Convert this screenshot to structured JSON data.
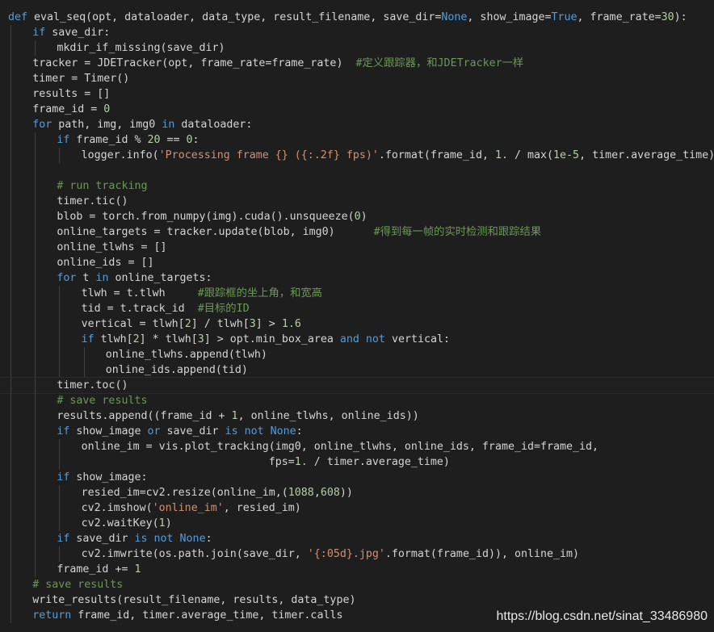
{
  "editor": {
    "lines": [
      {
        "indent": 0,
        "tokens": [
          [
            "kw",
            "def"
          ],
          [
            "pl",
            " eval_seq(opt, dataloader, data_type, result_filename, save_dir="
          ],
          [
            "kw",
            "None"
          ],
          [
            "pl",
            ", show_image="
          ],
          [
            "kw",
            "True"
          ],
          [
            "pl",
            ", frame_rate="
          ],
          [
            "num",
            "30"
          ],
          [
            "pl",
            "):"
          ]
        ]
      },
      {
        "indent": 1,
        "tokens": [
          [
            "kw",
            "if"
          ],
          [
            "pl",
            " save_dir:"
          ]
        ]
      },
      {
        "indent": 2,
        "tokens": [
          [
            "pl",
            "mkdir_if_missing(save_dir)"
          ]
        ]
      },
      {
        "indent": 1,
        "tokens": [
          [
            "pl",
            "tracker = JDETracker(opt, frame_rate=frame_rate)  "
          ],
          [
            "cm",
            "#定义跟踪器，和JDETracker一样"
          ]
        ]
      },
      {
        "indent": 1,
        "tokens": [
          [
            "pl",
            "timer = Timer()"
          ]
        ]
      },
      {
        "indent": 1,
        "tokens": [
          [
            "pl",
            "results = []"
          ]
        ]
      },
      {
        "indent": 1,
        "tokens": [
          [
            "pl",
            "frame_id = "
          ],
          [
            "num",
            "0"
          ]
        ]
      },
      {
        "indent": 1,
        "tokens": [
          [
            "kw",
            "for"
          ],
          [
            "pl",
            " path, img, img0 "
          ],
          [
            "kw",
            "in"
          ],
          [
            "pl",
            " dataloader:"
          ]
        ]
      },
      {
        "indent": 2,
        "tokens": [
          [
            "kw",
            "if"
          ],
          [
            "pl",
            " frame_id % "
          ],
          [
            "num",
            "20"
          ],
          [
            "pl",
            " == "
          ],
          [
            "num",
            "0"
          ],
          [
            "pl",
            ":"
          ]
        ]
      },
      {
        "indent": 3,
        "tokens": [
          [
            "pl",
            "logger.info("
          ],
          [
            "str",
            "'Processing frame {} ({:.2f} fps)'"
          ],
          [
            "pl",
            ".format(frame_id, "
          ],
          [
            "num",
            "1."
          ],
          [
            "pl",
            " / max("
          ],
          [
            "num",
            "1e-5"
          ],
          [
            "pl",
            ", timer.average_time)))"
          ]
        ]
      },
      {
        "indent": 2,
        "tokens": []
      },
      {
        "indent": 2,
        "tokens": [
          [
            "cm",
            "# run tracking"
          ]
        ]
      },
      {
        "indent": 2,
        "tokens": [
          [
            "pl",
            "timer.tic()"
          ]
        ]
      },
      {
        "indent": 2,
        "tokens": [
          [
            "pl",
            "blob = torch.from_numpy(img).cuda().unsqueeze("
          ],
          [
            "num",
            "0"
          ],
          [
            "pl",
            ")"
          ]
        ]
      },
      {
        "indent": 2,
        "tokens": [
          [
            "pl",
            "online_targets = tracker.update(blob, img0)      "
          ],
          [
            "cm",
            "#得到每一帧的实时检测和跟踪结果"
          ]
        ]
      },
      {
        "indent": 2,
        "tokens": [
          [
            "pl",
            "online_tlwhs = []"
          ]
        ]
      },
      {
        "indent": 2,
        "tokens": [
          [
            "pl",
            "online_ids = []"
          ]
        ]
      },
      {
        "indent": 2,
        "tokens": [
          [
            "kw",
            "for"
          ],
          [
            "pl",
            " t "
          ],
          [
            "kw",
            "in"
          ],
          [
            "pl",
            " online_targets:"
          ]
        ]
      },
      {
        "indent": 3,
        "tokens": [
          [
            "pl",
            "tlwh = t.tlwh     "
          ],
          [
            "cm",
            "#跟踪框的坐上角，和宽高"
          ]
        ]
      },
      {
        "indent": 3,
        "tokens": [
          [
            "pl",
            "tid = t.track_id  "
          ],
          [
            "cm",
            "#目标的ID"
          ]
        ]
      },
      {
        "indent": 3,
        "tokens": [
          [
            "pl",
            "vertical = tlwh["
          ],
          [
            "num",
            "2"
          ],
          [
            "pl",
            "] / tlwh["
          ],
          [
            "num",
            "3"
          ],
          [
            "pl",
            "] > "
          ],
          [
            "num",
            "1.6"
          ]
        ]
      },
      {
        "indent": 3,
        "tokens": [
          [
            "kw",
            "if"
          ],
          [
            "pl",
            " tlwh["
          ],
          [
            "num",
            "2"
          ],
          [
            "pl",
            "] * tlwh["
          ],
          [
            "num",
            "3"
          ],
          [
            "pl",
            "] > opt.min_box_area "
          ],
          [
            "kw",
            "and"
          ],
          [
            "pl",
            " "
          ],
          [
            "kw",
            "not"
          ],
          [
            "pl",
            " vertical:"
          ]
        ]
      },
      {
        "indent": 4,
        "tokens": [
          [
            "pl",
            "online_tlwhs.append(tlwh)"
          ]
        ]
      },
      {
        "indent": 4,
        "tokens": [
          [
            "pl",
            "online_ids.append(tid)"
          ]
        ]
      },
      {
        "indent": 2,
        "tokens": [
          [
            "pl",
            "timer.toc()"
          ]
        ],
        "current": true
      },
      {
        "indent": 2,
        "tokens": [
          [
            "cm",
            "# save results"
          ]
        ]
      },
      {
        "indent": 2,
        "tokens": [
          [
            "pl",
            "results.append((frame_id + "
          ],
          [
            "num",
            "1"
          ],
          [
            "pl",
            ", online_tlwhs, online_ids))"
          ]
        ]
      },
      {
        "indent": 2,
        "tokens": [
          [
            "kw",
            "if"
          ],
          [
            "pl",
            " show_image "
          ],
          [
            "kw",
            "or"
          ],
          [
            "pl",
            " save_dir "
          ],
          [
            "kw",
            "is"
          ],
          [
            "pl",
            " "
          ],
          [
            "kw",
            "not"
          ],
          [
            "pl",
            " "
          ],
          [
            "kw",
            "None"
          ],
          [
            "pl",
            ":"
          ]
        ]
      },
      {
        "indent": 3,
        "tokens": [
          [
            "pl",
            "online_im = vis.plot_tracking(img0, online_tlwhs, online_ids, frame_id=frame_id,"
          ]
        ]
      },
      {
        "indent": 3,
        "tokens": [
          [
            "pl",
            "                             fps="
          ],
          [
            "num",
            "1."
          ],
          [
            "pl",
            " / timer.average_time)"
          ]
        ]
      },
      {
        "indent": 2,
        "tokens": [
          [
            "kw",
            "if"
          ],
          [
            "pl",
            " show_image:"
          ]
        ]
      },
      {
        "indent": 3,
        "tokens": [
          [
            "pl",
            "resied_im=cv2.resize(online_im,("
          ],
          [
            "num",
            "1088"
          ],
          [
            "pl",
            ","
          ],
          [
            "num",
            "608"
          ],
          [
            "pl",
            "))"
          ]
        ]
      },
      {
        "indent": 3,
        "tokens": [
          [
            "pl",
            "cv2.imshow("
          ],
          [
            "str",
            "'online_im'"
          ],
          [
            "pl",
            ", resied_im)"
          ]
        ]
      },
      {
        "indent": 3,
        "tokens": [
          [
            "pl",
            "cv2.waitKey("
          ],
          [
            "num",
            "1"
          ],
          [
            "pl",
            ")"
          ]
        ]
      },
      {
        "indent": 2,
        "tokens": [
          [
            "kw",
            "if"
          ],
          [
            "pl",
            " save_dir "
          ],
          [
            "kw",
            "is"
          ],
          [
            "pl",
            " "
          ],
          [
            "kw",
            "not"
          ],
          [
            "pl",
            " "
          ],
          [
            "kw",
            "None"
          ],
          [
            "pl",
            ":"
          ]
        ]
      },
      {
        "indent": 3,
        "tokens": [
          [
            "pl",
            "cv2.imwrite(os.path.join(save_dir, "
          ],
          [
            "str",
            "'{:05d}.jpg'"
          ],
          [
            "pl",
            ".format(frame_id)), online_im)"
          ]
        ]
      },
      {
        "indent": 2,
        "tokens": [
          [
            "pl",
            "frame_id += "
          ],
          [
            "num",
            "1"
          ]
        ]
      },
      {
        "indent": 1,
        "tokens": [
          [
            "cm",
            "# save results"
          ]
        ]
      },
      {
        "indent": 1,
        "tokens": [
          [
            "pl",
            "write_results(result_filename, results, data_type)"
          ]
        ]
      },
      {
        "indent": 1,
        "tokens": [
          [
            "kw",
            "return"
          ],
          [
            "pl",
            " frame_id, timer.average_time, timer.calls"
          ]
        ]
      }
    ]
  },
  "watermark": "https://blog.csdn.net/sinat_33486980",
  "colors": {
    "background": "#1e1e1e",
    "keyword": "#569cd6",
    "string": "#ce9178",
    "number": "#b5cea8",
    "comment": "#6a9955",
    "text": "#d4d4d4"
  }
}
